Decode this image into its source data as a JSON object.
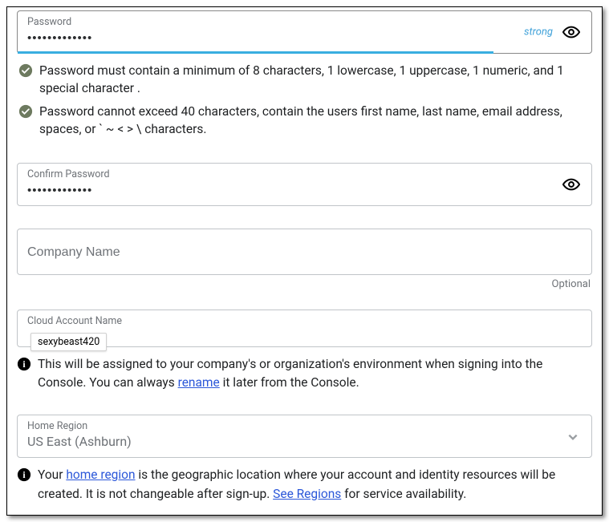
{
  "password": {
    "label": "Password",
    "value": "•••••••••••••",
    "strength": "strong"
  },
  "rules": [
    "Password must contain a minimum of 8 characters, 1 lowercase, 1 uppercase, 1 numeric, and 1 special character .",
    "Password cannot exceed 40 characters, contain the users first name, last name, email address, spaces, or ` ~ < > \\ characters."
  ],
  "confirm": {
    "label": "Confirm Password",
    "value": "•••••••••••••"
  },
  "company": {
    "placeholder": "Company Name",
    "optional": "Optional"
  },
  "cloudAccount": {
    "label": "Cloud Account Name",
    "autofill": "sexybeast420",
    "helper_pre": "This will be assigned to your company's or organization's environment when signing into the Console. You can always ",
    "helper_link": "rename",
    "helper_post": " it later from the Console."
  },
  "region": {
    "label": "Home Region",
    "value": "US East (Ashburn)",
    "helper_pre": "Your ",
    "helper_link1": "home region",
    "helper_mid": " is the geographic location where your account and identity resources will be created. It is not changeable after sign-up. ",
    "helper_link2": "See Regions",
    "helper_post": " for service availability."
  }
}
